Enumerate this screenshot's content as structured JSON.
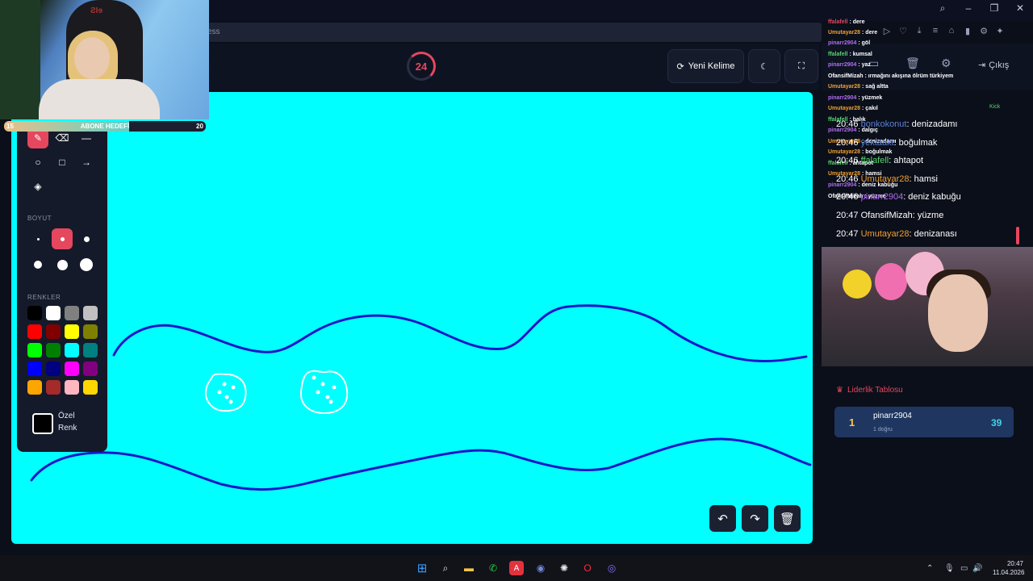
{
  "browser": {
    "address_fragment": "ess"
  },
  "header": {
    "timer": "24",
    "new_word_label": "Yeni Kelime",
    "exit_label": "Çıkış"
  },
  "tools_panel": {
    "size_label": "BOYUT",
    "colors_label": "RENKLER",
    "custom_color_line1": "Özel",
    "custom_color_line2": "Renk",
    "palette": [
      "#000000",
      "#ffffff",
      "#808080",
      "#c0c0c0",
      "#ff0000",
      "#800000",
      "#ffff00",
      "#808000",
      "#00ff00",
      "#008000",
      "#00ffff",
      "#008080",
      "#0000ff",
      "#000080",
      "#ff00ff",
      "#800080",
      "#ffa500",
      "#a52a2a",
      "#ffb6c1",
      "#ffd700"
    ],
    "canvas_color": "#00ffff",
    "accent_color": "#e5475e"
  },
  "stream_overlay": {
    "goal_left": "15",
    "goal_center": "ABONE HEDEFİ",
    "goal_right": "20",
    "goal_progress": 0.62,
    "chair_text": "ƧIɘ",
    "kick_label": "Kick"
  },
  "chat_small": [
    {
      "user": "ffalafell",
      "msg": "dere",
      "color": "#e5475e"
    },
    {
      "user": "Umutayar28",
      "msg": "dere",
      "color": "#f0a030"
    },
    {
      "user": "pinarr2904",
      "msg": "göl",
      "color": "#b06ef0"
    },
    {
      "user": "ffalafell",
      "msg": "kumsal",
      "color": "#53d769"
    },
    {
      "user": "pinarr2904",
      "msg": "yaz",
      "color": "#b06ef0"
    },
    {
      "user": "OfansifMizah",
      "msg": "ırmağını akışına ölrüm türkiyem",
      "color": "#ffffff"
    },
    {
      "user": "Umutayar28",
      "msg": "sağ altta",
      "color": "#f0a030"
    },
    {
      "user": "pinarr2904",
      "msg": "yüzmek",
      "color": "#b06ef0"
    },
    {
      "user": "Umutayar28",
      "msg": "çakıl",
      "color": "#f0a030"
    },
    {
      "user": "ffalafell",
      "msg": "balık",
      "color": "#53d769"
    },
    {
      "user": "pinarr2904",
      "msg": "dalgıç",
      "color": "#b06ef0"
    },
    {
      "user": "Umutayar28",
      "msg": "denizadamı",
      "color": "#f0a030"
    },
    {
      "user": "Umutayar28",
      "msg": "boğulmak",
      "color": "#f0a030"
    },
    {
      "user": "ffalafell",
      "msg": "ahtapot",
      "color": "#53d769"
    },
    {
      "user": "Umutayar28",
      "msg": "hamsi",
      "color": "#f0a030"
    },
    {
      "user": "pinarr2904",
      "msg": "deniz kabuğu",
      "color": "#b06ef0"
    },
    {
      "user": "OfansifMizah",
      "msg": "yüzme",
      "color": "#ffffff"
    }
  ],
  "chat_big": [
    {
      "time": "20:46",
      "user": "bonkokonut",
      "msg": "denizadamı",
      "color": "#5b7fd6"
    },
    {
      "time": "20:46",
      "user": "yektaakt",
      "msg": "boğulmak",
      "color": "#5b7fd6"
    },
    {
      "time": "20:46",
      "user": "ffalafell",
      "msg": "ahtapot",
      "color": "#53d769"
    },
    {
      "time": "20:46",
      "user": "Umutayar28",
      "msg": "hamsi",
      "color": "#f0a030"
    },
    {
      "time": "20:46",
      "user": "pinarr2904",
      "msg": "deniz kabuğu",
      "color": "#b06ef0"
    },
    {
      "time": "20:47",
      "user": "OfansifMizah",
      "msg": "yüzme",
      "color": "#ffffff"
    },
    {
      "time": "20:47",
      "user": "Umutayar28",
      "msg": "denizanası",
      "color": "#f0a030"
    }
  ],
  "leaderboard": {
    "title": "Liderlik Tablosu",
    "rows": [
      {
        "rank": "1",
        "name": "pinarr2904",
        "sub": "1 doğru",
        "score": "39"
      }
    ]
  },
  "taskbar": {
    "time": "20:47",
    "date": "11.04.2026",
    "discord_badge": "9+"
  }
}
